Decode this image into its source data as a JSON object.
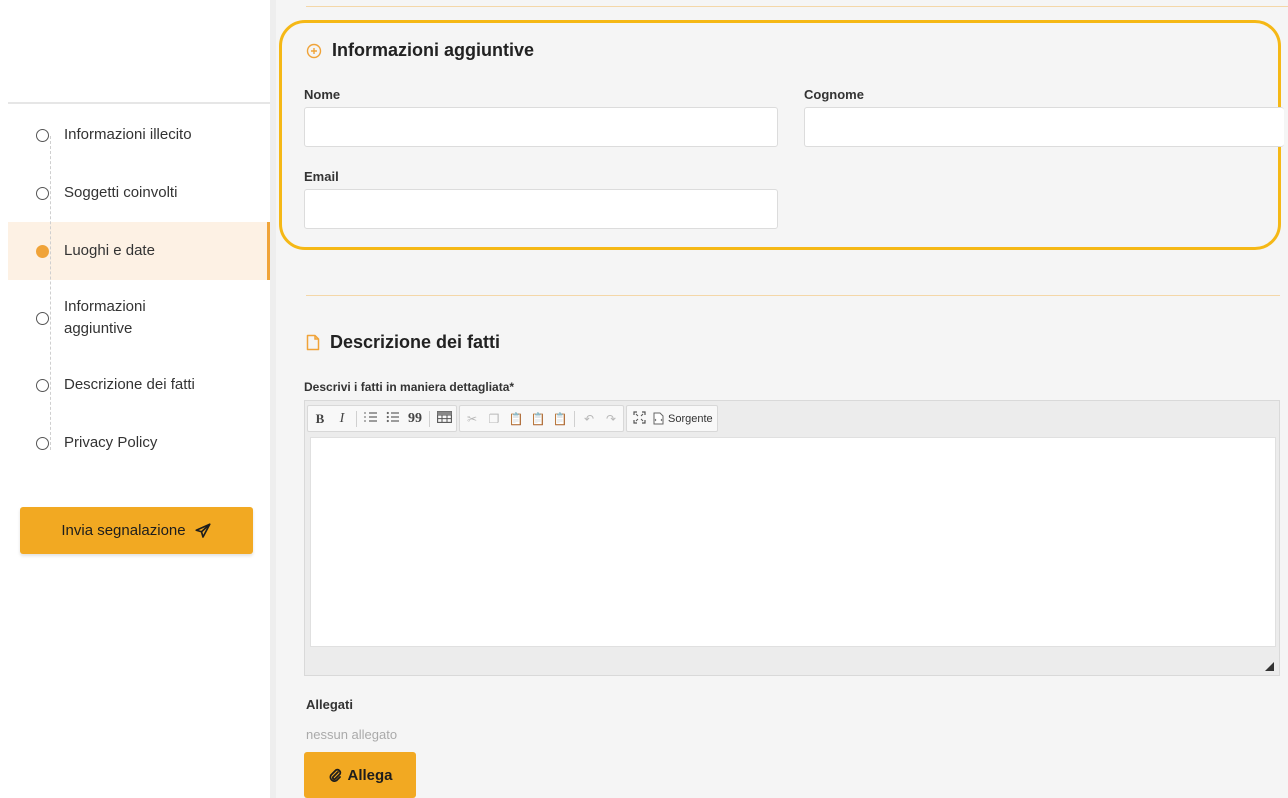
{
  "sidebar": {
    "steps": [
      {
        "label": "Informazioni illecito",
        "active": false
      },
      {
        "label": "Soggetti coinvolti",
        "active": false
      },
      {
        "label": "Luoghi e date",
        "active": true
      },
      {
        "label_line1": "Informazioni",
        "label_line2": "aggiuntive",
        "active": false
      },
      {
        "label": "Descrizione dei fatti",
        "active": false
      },
      {
        "label": "Privacy Policy",
        "active": false
      }
    ],
    "send_button": "Invia segnalazione",
    "send_icon": "paper-plane-icon"
  },
  "additional_info": {
    "title": "Informazioni aggiuntive",
    "icon": "plus-circle-icon",
    "nome_label": "Nome",
    "cognome_label": "Cognome",
    "email_label": "Email",
    "nome_value": "",
    "cognome_value": "",
    "email_value": ""
  },
  "description": {
    "title": "Descrizione dei fatti",
    "icon": "document-icon",
    "field_label": "Descrivi i fatti in maniera dettagliata*",
    "toolbar": {
      "bold": "B",
      "italic": "I",
      "blockquote": "99",
      "source_label": "Sorgente"
    }
  },
  "attachments": {
    "label": "Allegati",
    "empty_text": "nessun allegato",
    "button": "Allega",
    "button_icon": "paperclip-icon"
  },
  "colors": {
    "accent": "#f2a922",
    "highlight": "#f5b816",
    "active_bg": "#fdf1e4"
  }
}
